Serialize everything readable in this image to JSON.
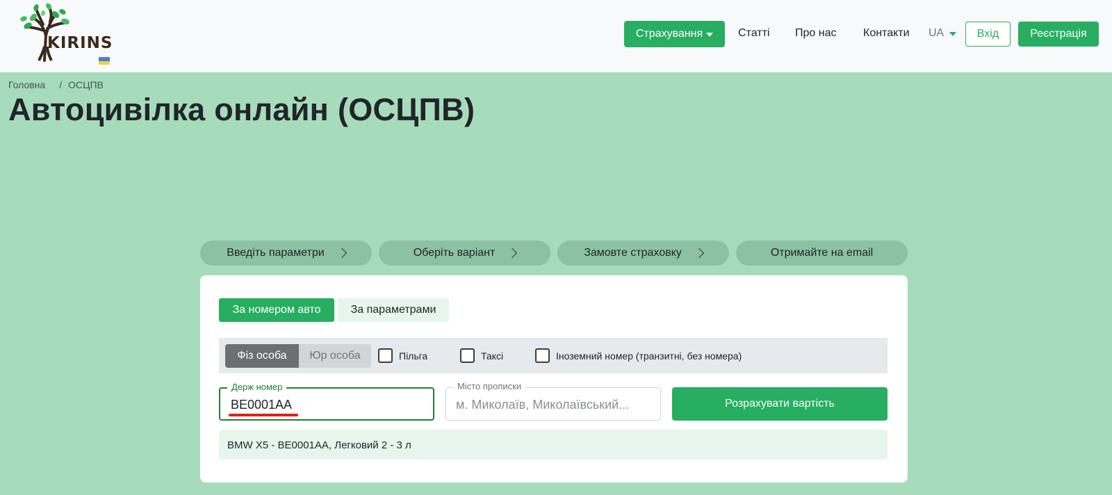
{
  "header": {
    "logo_text": "KIRINS",
    "nav": {
      "insurance": "Страхування",
      "articles": "Статті",
      "about": "Про нас",
      "contacts": "Контакти",
      "language": "UA",
      "login": "Вхід",
      "register": "Реєстрація"
    }
  },
  "breadcrumb": {
    "home": "Головна",
    "separator": "/",
    "current": "ОСЦПВ"
  },
  "page_title": "Автоцивілка онлайн (ОСЦПВ)",
  "steps": [
    {
      "label": "Введіть параметри"
    },
    {
      "label": "Оберіть варіант"
    },
    {
      "label": "Замовте страховку"
    },
    {
      "label": "Отримайте на email"
    }
  ],
  "form": {
    "tabs": {
      "by_number": "За номером авто",
      "by_params": "За параметрами"
    },
    "person_type": {
      "individual": "Фіз особа",
      "legal": "Юр особа"
    },
    "checkboxes": {
      "benefit": "Пільга",
      "taxi": "Таксі",
      "foreign": "Іноземний номер (транзитні, без номера)"
    },
    "plate": {
      "label": "Держ номер",
      "value": "BE0001AA"
    },
    "city": {
      "label": "Місто прописки",
      "placeholder": "м. Миколаїв, Миколаївський..."
    },
    "calculate_button": "Розрахувати вартість",
    "result": "BMW X5 - BE0001AA, Легковий 2 - 3 л"
  },
  "colors": {
    "brand_green": "#27ae60",
    "background": "#a6dcbc",
    "highlight_underline": "#e02020"
  }
}
